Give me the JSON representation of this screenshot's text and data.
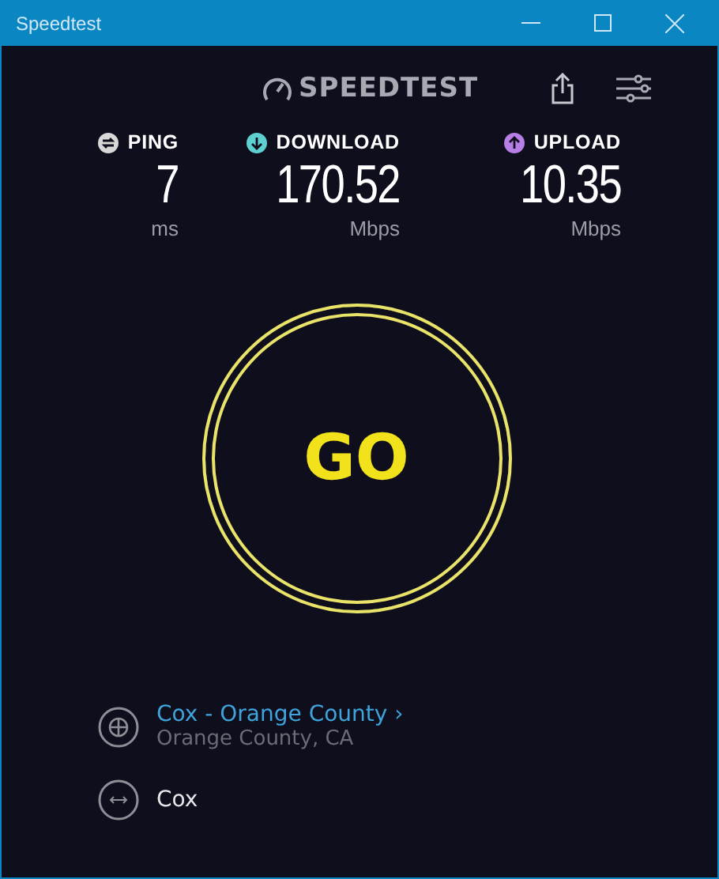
{
  "window": {
    "title": "Speedtest"
  },
  "header": {
    "logo": "SPEEDTEST"
  },
  "metrics": [
    {
      "kind": "ping",
      "label": "PING",
      "value": "7",
      "unit": "ms",
      "color": "#d8d8d8"
    },
    {
      "kind": "download",
      "label": "DOWNLOAD",
      "value": "170.52",
      "unit": "Mbps",
      "color": "#5fd0d0"
    },
    {
      "kind": "upload",
      "label": "UPLOAD",
      "value": "10.35",
      "unit": "Mbps",
      "color": "#b77ee6"
    }
  ],
  "go_button": {
    "label": "GO"
  },
  "server": {
    "name": "Cox - Orange County",
    "chevron": "›",
    "location": "Orange County, CA"
  },
  "provider": {
    "name": "Cox"
  }
}
